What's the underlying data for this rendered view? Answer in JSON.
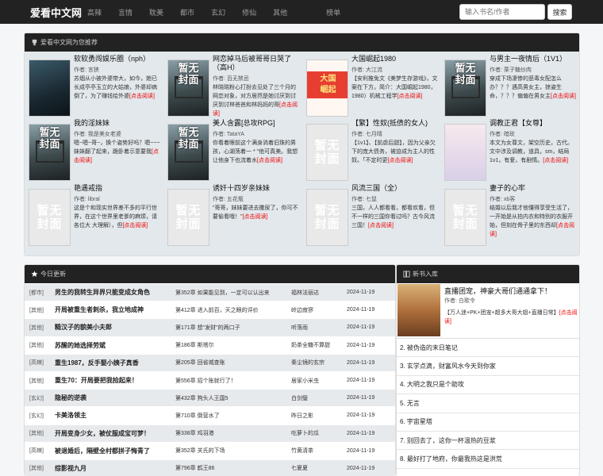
{
  "nav": {
    "brand": "爱看中文网",
    "items": [
      "高辣",
      "言情",
      "耽美",
      "都市",
      "玄幻",
      "修仙",
      "其他"
    ],
    "rank": "榜单",
    "search_placeholder": "输入书名/作者",
    "search_button": "搜索"
  },
  "recommend": {
    "title": "爱看中文网为您推荐",
    "more_label": "[点击阅读]",
    "no_cover": "暂无\n封面",
    "items": [
      {
        "title": "软软勇闯娱乐圈（nph）",
        "author": "作者: 言狭",
        "desc": "苏烟从小被外婆带大，如今，她已长成亭亭玉立的大姑娘，外婆却病倒了，为了赚钱给外婆",
        "cover": "photo1"
      },
      {
        "title": "网恋掉马后被哥哥日哭了（高H）",
        "author": "作者: 百无禁忌",
        "desc": "林晓晓粉心打扮去见处了三个月的网恋对象，对方居然是她讨厌到讨厌到讨林爸爸和林妈妈的哥",
        "cover": "ruin"
      },
      {
        "title": "大国崛起1980",
        "author": "作者: 大江流",
        "desc": "【安利推免文《美梦生存游戏》，文案在下方，简介：大国崛起1980，1980）机械工程学",
        "cover": "photo3"
      },
      {
        "title": "与男主一夜情后（1V1）",
        "author": "作者: 栗子糖炒肉",
        "desc": "穿成下场凄惨的恶毒女配怎么办？？？遇高男女主，掠姿生命，？？？偏偏在男女主",
        "cover": "ruin"
      },
      {
        "title": "我的淫妹妹",
        "author": "作者: 我是美女老婆",
        "desc": "嗯~嗯~哥~，换个姿势好吗？嗯~~~妹妹翻了起来，跪卧着示意要我",
        "cover": "ruin"
      },
      {
        "title": "美人含露[总攻RPG]",
        "author": "作者: TataYA",
        "desc": "你看着眼前这个满身淌着旧珠的男孩，心湖荡着一 * \"他可真美。我想让他身下也流着水",
        "cover": "ruin"
      },
      {
        "title": "【繁】性奴(抵债的女人)",
        "author": "作者: 七月晴",
        "desc": "【1v1】、【前虐后甜】，因为父亲欠下的庞大债务，被迫成为主人的性奴。「不定时更",
        "cover": "none"
      },
      {
        "title": "调教正君【女尊】",
        "author": "作者: 暗玫",
        "desc": "本文为女尊文，架空历史，古代。文中涉及调教，道具，sm，结局1v1，有爱，有剧情。",
        "cover": "photo4"
      },
      {
        "title": "艳遇戒指",
        "author": "作者: libral",
        "desc": "这是个和现实世界差不多的平行世界，在这个世界里老爹的麻烦，请各位大 大理解），但",
        "cover": "none"
      },
      {
        "title": "诱奸十四岁亲妹妹",
        "author": "作者: 五花瓶",
        "desc": "\"哥哥，妹妹要进去撒尿了，你可不要偷看哦！\"",
        "cover": "none"
      },
      {
        "title": "风流三国（全）",
        "author": "作者: 七鼠",
        "desc": "三国，人人都看看，都看欢看，但不一样的三国你看过吗？古今风流三国！",
        "cover": "none"
      },
      {
        "title": "妻子的心牢",
        "author": "作者: xb客",
        "desc": "结婚以后我才他懂得享受生活了，一开始是从拍内衣和特别的衣服开始，但刻在骨子里的东西却",
        "cover": "none"
      }
    ]
  },
  "updates": {
    "title": "今日更新",
    "rows": [
      {
        "cat": "[都市]",
        "book": "男生的我转生异界只能变成女角色",
        "chapter": "第352章 如果能见到，一定可以认出来",
        "author": "福林法丽达",
        "date": "2024-11-19"
      },
      {
        "cat": "[其他]",
        "book": "开局被重生者刺杀，我立地成神",
        "chapter": "第412章 进入前百，天之眼的评价",
        "author": "岭边寂寥",
        "date": "2024-11-19"
      },
      {
        "cat": "[其他]",
        "book": "糙汉子的貌美小夫郎",
        "chapter": "第171章 想\"发财\"的两口子",
        "author": "听落雨",
        "date": "2024-11-19"
      },
      {
        "cat": "[其他]",
        "book": "苏醒的她选择劳斌",
        "chapter": "第186章 斯塔尔",
        "author": "奶茶全糖不算甜",
        "date": "2024-11-19"
      },
      {
        "cat": "[高辣]",
        "book": "重生1987，反手娶小姨子真香",
        "chapter": "第205章 回省城查账",
        "author": "秦尘镜的玄宗",
        "date": "2024-11-19"
      },
      {
        "cat": "[其他]",
        "book": "重生70：开局要把我捡起来！",
        "chapter": "第556章 招个账就行了！",
        "author": "居家小米虫",
        "date": "2024-11-19"
      },
      {
        "cat": "[玄幻]",
        "book": "隐秘的逆袭",
        "chapter": "第432章 狗头人王国5",
        "author": "白剑璧",
        "date": "2024-11-19"
      },
      {
        "cat": "[玄幻]",
        "book": "卡美洛领主",
        "chapter": "第710章 倒营水了",
        "author": "昨日之影",
        "date": "2024-11-19"
      },
      {
        "cat": "[其他]",
        "book": "开局变身少女，被仗服成宝可梦！",
        "chapter": "第338章 鸡羽港",
        "author": "吃萝卜的瓜",
        "date": "2024-11-19"
      },
      {
        "cat": "[高辣]",
        "book": "被退婚后，隔壁全村都拼子悔青了",
        "chapter": "第352章 关氏的下场",
        "author": "竹黄清茶",
        "date": "2024-11-19"
      },
      {
        "cat": "[其他]",
        "book": "综影视九月",
        "chapter": "第796章 鹤王86",
        "author": "七夏夏",
        "date": "2024-11-19"
      }
    ]
  },
  "newbooks": {
    "title": "新书入库",
    "top": {
      "title": "直播团宠，神豪大哥们通通拿下！",
      "author": "作者: 白歌令",
      "desc": "【万人迷+PK+团宠+超多大哥大姐+直播日常】",
      "more": "[点击阅读]"
    },
    "items": [
      "2. 被伪造的末日笔记",
      "3. 玄学点滴，财富风水今天到你家",
      "4. 大明之我只是个助攻",
      "5. 无言",
      "6. 宇宙星塔",
      "7. 别回去了，这你一杯温热的豆浆",
      "8. 最好打了地府，你最我热这是洪荒"
    ]
  },
  "colors": {
    "nav_bg": "#222222",
    "link_red": "#ee0000",
    "panel_bg": "#e2e8ec"
  }
}
